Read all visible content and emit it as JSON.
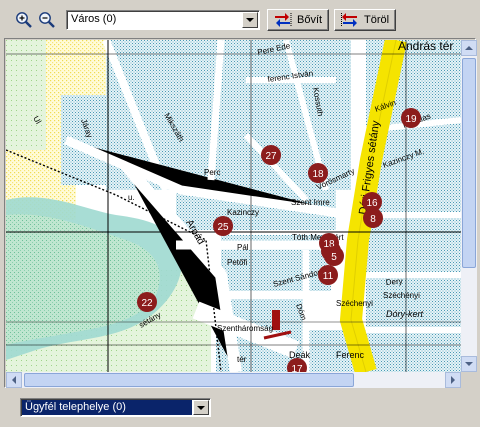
{
  "toolbar": {
    "zoom_in_icon": "zoom-in-magnifier",
    "zoom_out_icon": "zoom-out-magnifier",
    "city_select_value": "Város (0)",
    "expand_label": "Bővít",
    "delete_label": "Töröl"
  },
  "map": {
    "streets": [
      "Pere Ede",
      "ferenc István",
      "Kossuth",
      "Mikszáth",
      "Szent Imre",
      "Perc",
      "Kazinczy",
      "Vörösmarty",
      "Kálvin",
      "Kanalas",
      "Kazinczy M.",
      "Tóth Menyhért",
      "Pál",
      "Petőfi",
      "Szent Sándor",
      "Arpád",
      "sétány",
      "tér",
      "Dóm",
      "Széchenyi",
      "Dery",
      "Széchényi",
      "Szentháromság",
      "Deák",
      "Ferenc",
      "Dóry-kert",
      "Ul",
      "Járay",
      "u."
    ],
    "places": [
      "András tér",
      "Szentháromság tér",
      "Déri Frigyes sétány",
      "Dóry-kert"
    ],
    "markers": [
      "27",
      "18",
      "19",
      "16",
      "8",
      "25",
      "8",
      "18",
      "5",
      "11",
      "22",
      "17"
    ]
  },
  "bottom": {
    "client_select_value": "Ügyfél telephelye (0)"
  }
}
